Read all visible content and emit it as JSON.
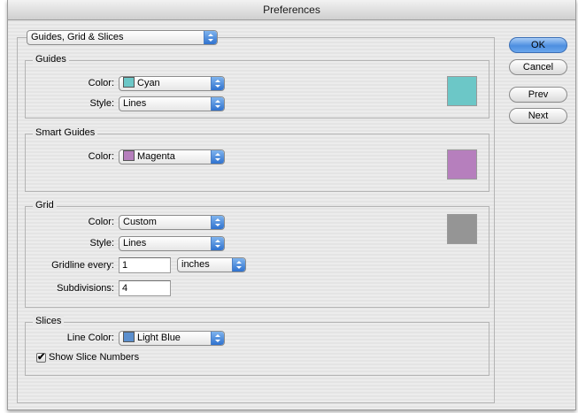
{
  "window": {
    "title": "Preferences"
  },
  "section_menu": {
    "value": "Guides, Grid & Slices"
  },
  "buttons": {
    "ok": "OK",
    "cancel": "Cancel",
    "prev": "Prev",
    "next": "Next"
  },
  "guides": {
    "title": "Guides",
    "color_label": "Color:",
    "color_value": "Cyan",
    "color_hex": "#6cc7c7",
    "style_label": "Style:",
    "style_value": "Lines"
  },
  "smart_guides": {
    "title": "Smart Guides",
    "color_label": "Color:",
    "color_value": "Magenta",
    "color_hex": "#b67fbd"
  },
  "grid": {
    "title": "Grid",
    "color_label": "Color:",
    "color_value": "Custom",
    "color_hex": "#959595",
    "style_label": "Style:",
    "style_value": "Lines",
    "gridline_label": "Gridline every:",
    "gridline_value": "1",
    "gridline_unit": "inches",
    "subdivisions_label": "Subdivisions:",
    "subdivisions_value": "4"
  },
  "slices": {
    "title": "Slices",
    "line_color_label": "Line Color:",
    "line_color_value": "Light Blue",
    "line_color_hex": "#5b8fce",
    "show_numbers_label": "Show Slice Numbers",
    "show_numbers_checked": true
  }
}
